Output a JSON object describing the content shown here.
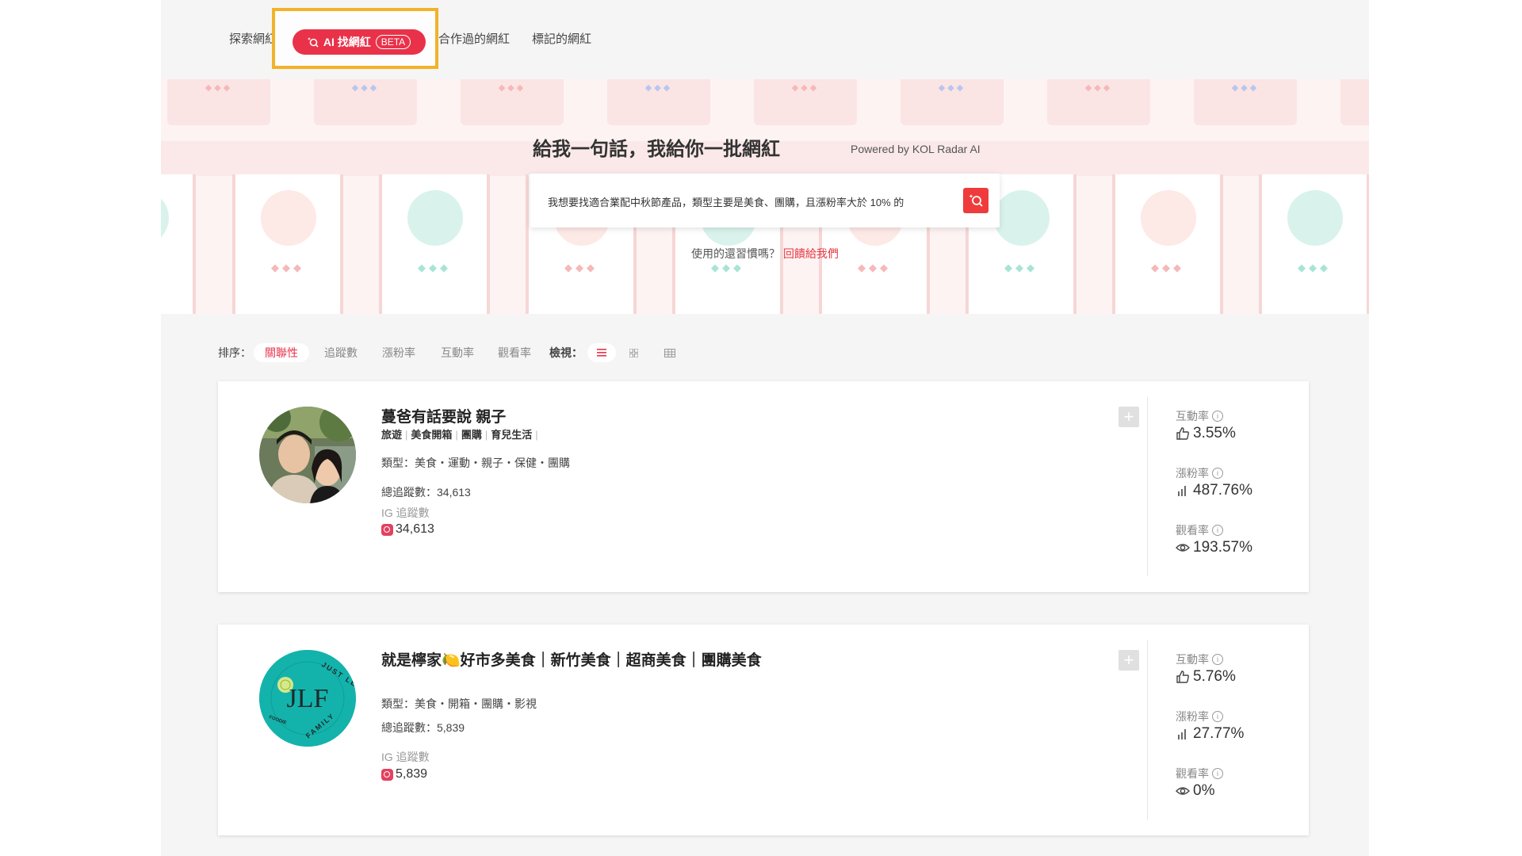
{
  "nav": {
    "tabs": [
      "探索網紅",
      "合作過的網紅",
      "標記的網紅"
    ],
    "ai_tab": {
      "label": "AI 找網紅",
      "badge": "BETA"
    }
  },
  "hero": {
    "title": "給我一句話，我給你一批網紅",
    "powered_by": "Powered by KOL Radar AI",
    "search_value": "我想要找適合業配中秋節產品，類型主要是美食、團購，且漲粉率大於 10% 的",
    "feedback_prompt": "使用的還習慣嗎？",
    "feedback_link": "回饋給我們"
  },
  "toolbar": {
    "sort_label": "排序：",
    "sort_options": [
      "關聯性",
      "追蹤數",
      "漲粉率",
      "互動率",
      "觀看率"
    ],
    "view_label": "檢視：",
    "view_icons": [
      "list-view-icon",
      "card-view-icon",
      "table-view-icon"
    ]
  },
  "stat_labels": {
    "engagement": "互動率",
    "growth": "漲粉率",
    "view": "觀看率"
  },
  "kols": [
    {
      "name": "蔓爸有話要說 親子",
      "tags": [
        "旅遊",
        "美食開箱",
        "團購",
        "育兒生活"
      ],
      "types": "類型：美食・運動・親子・保健・團購",
      "total_followers": "總追蹤數：34,613",
      "ig_label": "IG 追蹤數",
      "ig_followers": "34,613",
      "engagement": "3.55%",
      "growth": "487.76%",
      "view": "193.57%"
    },
    {
      "name": "就是檸家🍋好市多美食｜新竹美食｜超商美食｜團購美食",
      "tags": [],
      "types": "類型：美食・開箱・團購・影視",
      "total_followers": "總追蹤數：5,839",
      "ig_label": "IG 追蹤數",
      "ig_followers": "5,839",
      "engagement": "5.76%",
      "growth": "27.77%",
      "view": "0%",
      "avatar_text": {
        "logo": "JLF",
        "ring_top": "JUST LEMON",
        "ring_bottom": "FAMILY",
        "side": "FOODIE"
      }
    }
  ],
  "colors": {
    "accent": "#e9324a",
    "highlight": "#f2b229",
    "avatar_teal": "#13b3ac"
  }
}
